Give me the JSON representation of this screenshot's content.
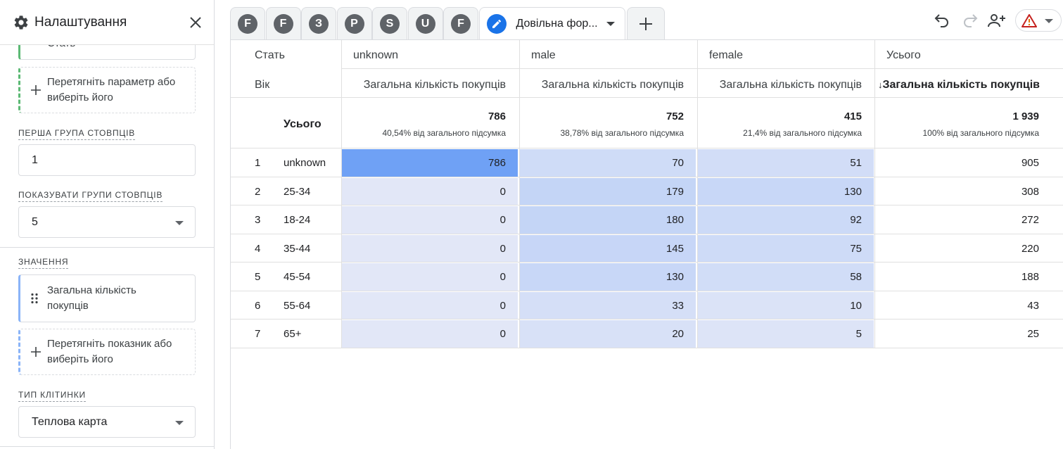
{
  "panel": {
    "title": "Налаштування",
    "rows_card_label": "Стать",
    "drop_dimension": "Перетягніть параметр або виберіть його",
    "first_col_group_label": "ПЕРША ГРУПА СТОВПЦІВ",
    "first_col_group_value": "1",
    "show_col_groups_label": "ПОКАЗУВАТИ ГРУПИ СТОВПЦІВ",
    "show_col_groups_value": "5",
    "values_label": "ЗНАЧЕННЯ",
    "metric_card": "Загальна кількість покупців",
    "drop_metric": "Перетягніть показник або виберіть його",
    "cell_type_label": "ТИП КЛІТИНКИ",
    "cell_type_value": "Теплова карта"
  },
  "tabs": {
    "chips": [
      "F",
      "F",
      "З",
      "P",
      "S",
      "U",
      "F"
    ],
    "active_label": "Довільна фор..."
  },
  "colors": {
    "accent": "#1a73e8",
    "heat_max": "#6fa1f5",
    "heat_low": "#e2e7f7"
  },
  "table": {
    "row_dim_header": "Стать",
    "col_dim_header": "Вік",
    "columns": [
      "unknown",
      "male",
      "female",
      "Усього"
    ],
    "metric": "Загальна кількість покупців",
    "total_label": "Усього",
    "totals": [
      {
        "value": "786",
        "pct": "40,54% від загального підсумка"
      },
      {
        "value": "752",
        "pct": "38,78% від загального підсумка"
      },
      {
        "value": "415",
        "pct": "21,4% від загального підсумка"
      },
      {
        "value": "1 939",
        "pct": "100% від загального підсумка"
      }
    ],
    "rows": [
      {
        "idx": "1",
        "label": "unknown",
        "values": [
          786,
          70,
          51
        ],
        "total": "905"
      },
      {
        "idx": "2",
        "label": "25-34",
        "values": [
          0,
          179,
          130
        ],
        "total": "308"
      },
      {
        "idx": "3",
        "label": "18-24",
        "values": [
          0,
          180,
          92
        ],
        "total": "272"
      },
      {
        "idx": "4",
        "label": "35-44",
        "values": [
          0,
          145,
          75
        ],
        "total": "220"
      },
      {
        "idx": "5",
        "label": "45-54",
        "values": [
          0,
          130,
          58
        ],
        "total": "188"
      },
      {
        "idx": "6",
        "label": "55-64",
        "values": [
          0,
          33,
          10
        ],
        "total": "43"
      },
      {
        "idx": "7",
        "label": "65+",
        "values": [
          0,
          20,
          5
        ],
        "total": "25"
      }
    ]
  }
}
